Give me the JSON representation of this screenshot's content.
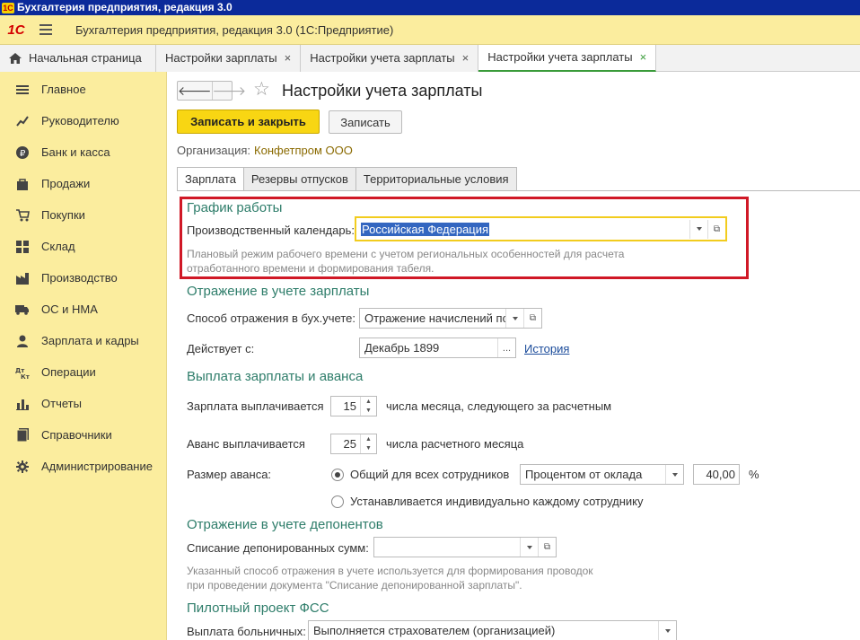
{
  "window": {
    "title": "Бухгалтерия предприятия, редакция 3.0",
    "logo": "1С"
  },
  "appbar": {
    "brand": "1С",
    "title": "Бухгалтерия предприятия, редакция 3.0  (1С:Предприятие)"
  },
  "tabs": [
    {
      "label": "Начальная страница",
      "icon": "home-icon"
    },
    {
      "label": "Настройки зарплаты",
      "close": "×"
    },
    {
      "label": "Настройки учета зарплаты",
      "close": "×"
    },
    {
      "label": "Настройки учета зарплаты",
      "close": "×",
      "active": true
    }
  ],
  "sidebar": {
    "items": [
      {
        "label": "Главное",
        "icon": "menu-list-icon"
      },
      {
        "label": "Руководителю",
        "icon": "chart-icon"
      },
      {
        "label": "Банк и касса",
        "icon": "ruble-icon"
      },
      {
        "label": "Продажи",
        "icon": "bag-icon"
      },
      {
        "label": "Покупки",
        "icon": "cart-icon"
      },
      {
        "label": "Склад",
        "icon": "warehouse-icon"
      },
      {
        "label": "Производство",
        "icon": "factory-icon"
      },
      {
        "label": "ОС и НМА",
        "icon": "truck-icon"
      },
      {
        "label": "Зарплата и кадры",
        "icon": "person-icon"
      },
      {
        "label": "Операции",
        "icon": "dt-kt-icon"
      },
      {
        "label": "Отчеты",
        "icon": "bar-chart-icon"
      },
      {
        "label": "Справочники",
        "icon": "book-icon"
      },
      {
        "label": "Администрирование",
        "icon": "gear-icon"
      }
    ]
  },
  "main": {
    "nav": {
      "back": "🡐",
      "forward": "🡒"
    },
    "star": "☆",
    "title": "Настройки учета зарплаты",
    "btn_save_close": "Записать и закрыть",
    "btn_save": "Записать",
    "org_label": "Организация:",
    "org_value": "Конфетпром ООО",
    "form_tabs": [
      "Зарплата",
      "Резервы отпусков",
      "Территориальные условия"
    ],
    "schedule": {
      "section": "График работы",
      "calendar_label": "Производственный календарь:",
      "calendar_value": "Российская Федерация",
      "hint_line1": "Плановый режим рабочего времени с учетом региональных особенностей для расчета",
      "hint_line2": "отработанного времени и формирования табеля."
    },
    "accounting": {
      "section": "Отражение в учете зарплаты",
      "method_label": "Способ отражения в бух.учете:",
      "method_value": "Отражение начислений по",
      "valid_label": "Действует с:",
      "valid_value": "Декабрь 1899",
      "history_link": "История"
    },
    "payment": {
      "section": "Выплата зарплаты и аванса",
      "salary_label": "Зарплата выплачивается",
      "salary_day": "15",
      "salary_suffix": "числа месяца, следующего за расчетным",
      "advance_label": "Аванс выплачивается",
      "advance_day": "25",
      "advance_suffix": "числа расчетного месяца",
      "advance_size_label": "Размер аванса:",
      "radio_common": "Общий для всех сотрудников",
      "radio_individual": "Устанавливается индивидуально каждому сотруднику",
      "advance_method": "Процентом от оклада",
      "advance_percent": "40,00",
      "percent_sign": "%"
    },
    "deponents": {
      "section": "Отражение в учете депонентов",
      "writeoff_label": "Списание депонированных сумм:",
      "writeoff_value": "",
      "hint_line1": "Указанный способ отражения в учете используется для формирования проводок",
      "hint_line2": "при проведении документа \"Списание депонированной зарплаты\"."
    },
    "fss": {
      "section": "Пилотный проект ФСС",
      "sick_label": "Выплата больничных:",
      "sick_value": "Выполняется страхователем (организацией)"
    }
  }
}
